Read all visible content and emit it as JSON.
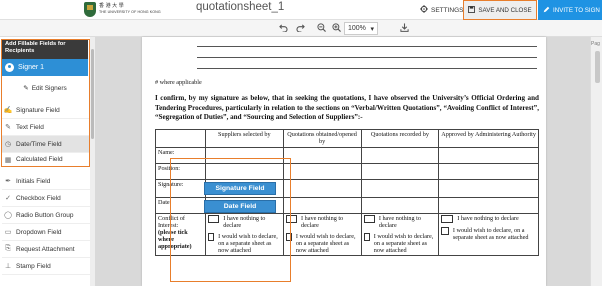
{
  "header": {
    "logo_cn": "香 港 大 學",
    "logo_en": "THE UNIVERSITY OF HONG KONG",
    "doc_title": "quotationsheet_1",
    "settings_label": "SETTINGS",
    "save_close_label": "SAVE AND CLOSE",
    "invite_label": "INVITE TO SIGN"
  },
  "toolbar": {
    "zoom": "100%"
  },
  "sidebar": {
    "header": "Add Fillable Fields for Recipients",
    "signer": "Signer 1",
    "edit_signers": "Edit Signers",
    "items": [
      {
        "label": "Signature Field"
      },
      {
        "label": "Text Field"
      },
      {
        "label": "Date/Time Field"
      },
      {
        "label": "Calculated Field"
      },
      {
        "label": "Initials Field"
      },
      {
        "label": "Checkbox Field"
      },
      {
        "label": "Radio Button Group"
      },
      {
        "label": "Dropdown Field"
      },
      {
        "label": "Request Attachment"
      },
      {
        "label": "Stamp Field"
      }
    ]
  },
  "document": {
    "note": "# where applicable",
    "statement": "I confirm, by my signature as below, that in seeking the quotations, I have observed the University’s Official Ordering and Tendering Procedures, particularly in relation to the sections on “Verbal/Written Quotations”, “Avoiding Conflict of Interest”, “Segregation of Duties”, and “Sourcing and Selection of Suppliers”:-",
    "table": {
      "headers": [
        "Suppliers selected by",
        "Quotations obtained/opened by",
        "Quotations recorded by",
        "Approved by Administering Authority"
      ],
      "rows": [
        "Name:",
        "Position:",
        "Signature:",
        "Date:"
      ],
      "conflict_label_1": "Conflict of Interest:",
      "conflict_label_2": "(please tick where appropriate)",
      "option_nothing": "I have nothing to declare",
      "option_wish": "I would wish to declare, on a separate sheet as now attached"
    },
    "fields": {
      "signature": "Signature Field",
      "date": "Date Field"
    }
  },
  "right_panel": {
    "label": "Pag"
  }
}
